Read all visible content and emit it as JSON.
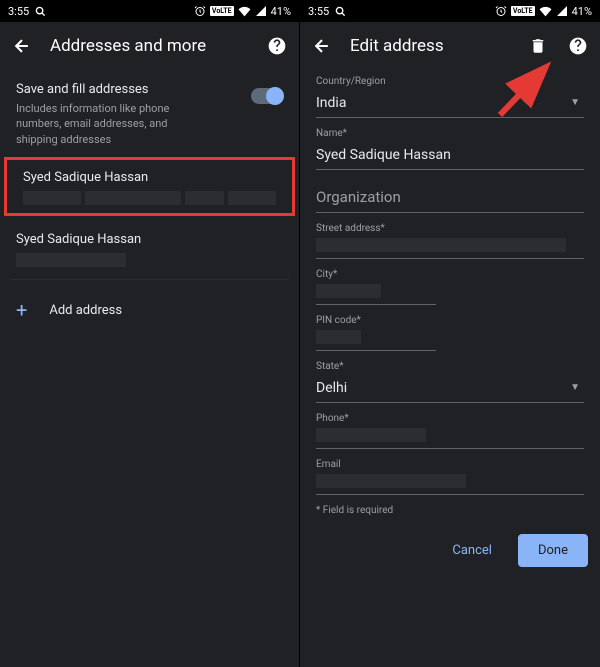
{
  "status_bar": {
    "time": "3:55",
    "battery": "41%"
  },
  "left_screen": {
    "title": "Addresses and more",
    "toggle": {
      "title": "Save and fill addresses",
      "description": "Includes information like phone numbers, email addresses, and shipping addresses",
      "enabled": true
    },
    "addresses": [
      {
        "name": "Syed Sadique Hassan"
      },
      {
        "name": "Syed Sadique Hassan"
      }
    ],
    "add_label": "Add address"
  },
  "right_screen": {
    "title": "Edit address",
    "fields": {
      "country_label": "Country/Region",
      "country_value": "India",
      "name_label": "Name*",
      "name_value": "Syed Sadique Hassan",
      "organization_placeholder": "Organization",
      "street_label": "Street address*",
      "city_label": "City*",
      "pin_label": "PIN code*",
      "state_label": "State*",
      "state_value": "Delhi",
      "phone_label": "Phone*",
      "email_label": "Email"
    },
    "required_note": "* Field is required",
    "buttons": {
      "cancel": "Cancel",
      "done": "Done"
    }
  }
}
